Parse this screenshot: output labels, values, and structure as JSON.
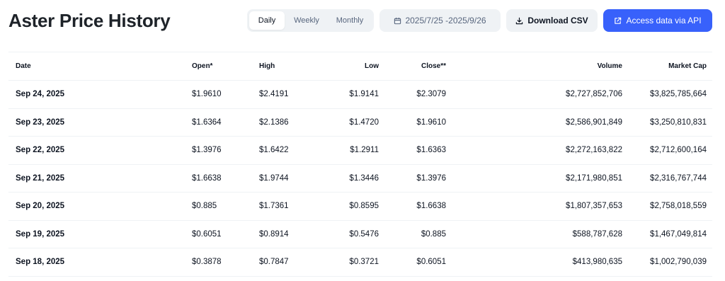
{
  "page": {
    "title": "Aster Price History"
  },
  "toolbar": {
    "periods": [
      {
        "label": "Daily",
        "active": true
      },
      {
        "label": "Weekly",
        "active": false
      },
      {
        "label": "Monthly",
        "active": false
      }
    ],
    "date_range": {
      "label": "2025/7/25 -2025/9/26",
      "icon": "calendar-icon"
    },
    "download": {
      "label": "Download CSV",
      "icon": "download-icon"
    },
    "api": {
      "label": "Access data via API",
      "icon": "external-link-icon"
    },
    "colors": {
      "accent": "#3861fb",
      "button_bg": "#eff2f5"
    }
  },
  "table": {
    "headers": {
      "date": "Date",
      "open": "Open*",
      "high": "High",
      "low": "Low",
      "close": "Close**",
      "volume": "Volume",
      "market_cap": "Market Cap"
    },
    "rows": [
      {
        "date": "Sep 24, 2025",
        "open": "$1.9610",
        "high": "$2.4191",
        "low": "$1.9141",
        "close": "$2.3079",
        "volume": "$2,727,852,706",
        "market_cap": "$3,825,785,664"
      },
      {
        "date": "Sep 23, 2025",
        "open": "$1.6364",
        "high": "$2.1386",
        "low": "$1.4720",
        "close": "$1.9610",
        "volume": "$2,586,901,849",
        "market_cap": "$3,250,810,831"
      },
      {
        "date": "Sep 22, 2025",
        "open": "$1.3976",
        "high": "$1.6422",
        "low": "$1.2911",
        "close": "$1.6363",
        "volume": "$2,272,163,822",
        "market_cap": "$2,712,600,164"
      },
      {
        "date": "Sep 21, 2025",
        "open": "$1.6638",
        "high": "$1.9744",
        "low": "$1.3446",
        "close": "$1.3976",
        "volume": "$2,171,980,851",
        "market_cap": "$2,316,767,744"
      },
      {
        "date": "Sep 20, 2025",
        "open": "$0.885",
        "high": "$1.7361",
        "low": "$0.8595",
        "close": "$1.6638",
        "volume": "$1,807,357,653",
        "market_cap": "$2,758,018,559"
      },
      {
        "date": "Sep 19, 2025",
        "open": "$0.6051",
        "high": "$0.8914",
        "low": "$0.5476",
        "close": "$0.885",
        "volume": "$588,787,628",
        "market_cap": "$1,467,049,814"
      },
      {
        "date": "Sep 18, 2025",
        "open": "$0.3878",
        "high": "$0.7847",
        "low": "$0.3721",
        "close": "$0.6051",
        "volume": "$413,980,635",
        "market_cap": "$1,002,790,039"
      }
    ]
  }
}
